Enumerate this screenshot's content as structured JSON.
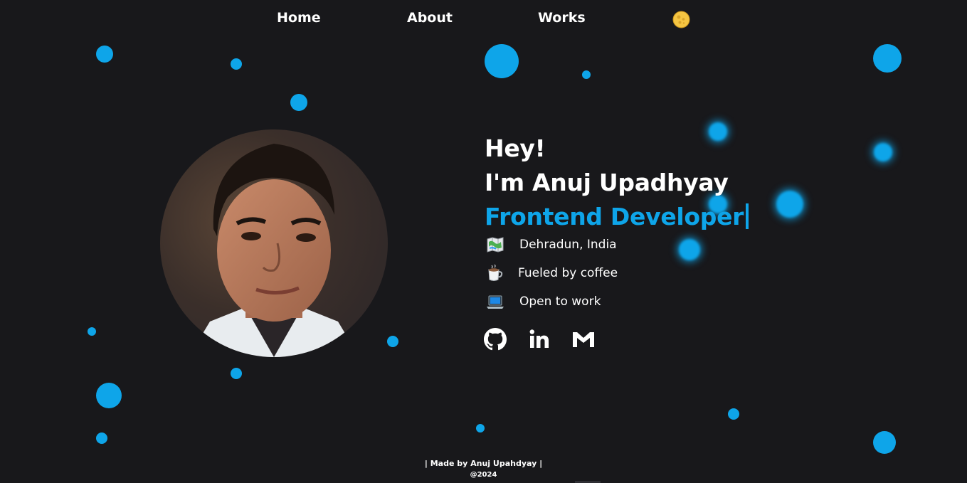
{
  "nav": {
    "home_label": "Home",
    "about_label": "About",
    "works_label": "Works",
    "theme_toggle_icon": "moon-icon"
  },
  "colors": {
    "background": "#18181b",
    "accent": "#0ea5e9",
    "text": "#ffffff"
  },
  "profile": {
    "avatar_icon": "profile-photo"
  },
  "hero": {
    "greeting": "Hey!",
    "intro": "I'm Anuj Upadhyay",
    "role": "Frontend Developer"
  },
  "info": [
    {
      "icon": "map-icon",
      "text": "Dehradun, India"
    },
    {
      "icon": "coffee-icon",
      "text": "Fueled by coffee"
    },
    {
      "icon": "laptop-icon",
      "text": "Open to work"
    }
  ],
  "social": [
    {
      "icon": "github-icon"
    },
    {
      "icon": "linkedin-icon"
    },
    {
      "icon": "gmail-icon"
    }
  ],
  "footer": {
    "line1": "| Made by Anuj Upahdyay |",
    "line2": "@2024"
  }
}
